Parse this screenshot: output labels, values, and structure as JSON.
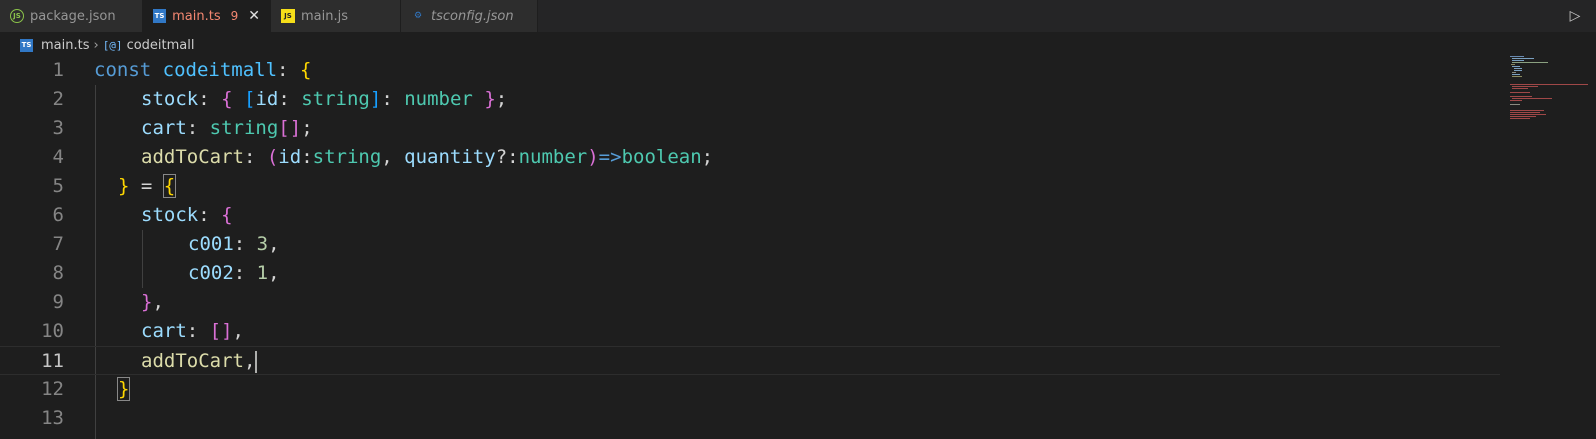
{
  "tabs": [
    {
      "label": "package.json",
      "icon": "json-file-icon",
      "badge": "",
      "italic": false
    },
    {
      "label": "main.ts",
      "icon": "typescript-file-icon",
      "badge": "9",
      "italic": false
    },
    {
      "label": "main.js",
      "icon": "javascript-file-icon",
      "badge": "",
      "italic": false
    },
    {
      "label": "tsconfig.json",
      "icon": "tsconfig-file-icon",
      "badge": "",
      "italic": true
    }
  ],
  "active_tab": "main.ts",
  "breadcrumb": {
    "file": "main.ts",
    "symbol": "codeitmall"
  },
  "line_numbers": [
    "1",
    "2",
    "3",
    "4",
    "5",
    "6",
    "7",
    "8",
    "9",
    "10",
    "11",
    "12",
    "13"
  ],
  "current_line": "11",
  "code": {
    "l1": [
      "const",
      " ",
      "codeitmall",
      ": ",
      "{"
    ],
    "l2": [
      "stock",
      ": ",
      "{",
      " ",
      "[",
      "id",
      ": ",
      "string",
      "]",
      ": ",
      "number",
      " ",
      "}",
      ";"
    ],
    "l3": [
      "cart",
      ": ",
      "string",
      "[]",
      ";"
    ],
    "l4": [
      "addToCart",
      ": ",
      "(",
      "id",
      ":",
      "string",
      ", ",
      "quantity",
      "?:",
      "number",
      ")",
      "=>",
      "boolean",
      ";"
    ],
    "l5": [
      "}",
      " = ",
      "{"
    ],
    "l6": [
      "stock",
      ": ",
      "{"
    ],
    "l7": [
      "c001",
      ": ",
      "3",
      ","
    ],
    "l8": [
      "c002",
      ": ",
      "1",
      ","
    ],
    "l9": [
      "}",
      ","
    ],
    "l10": [
      "cart",
      ": ",
      "[]",
      ","
    ],
    "l11": [
      "addToCart",
      ","
    ],
    "l12": [
      "}"
    ]
  },
  "colors": {
    "keyword": "#569cd6",
    "variable": "#4fc1ff",
    "property": "#9cdcfe",
    "type": "#4ec9b0",
    "function": "#dcdcaa",
    "number": "#b5cea8",
    "bracket_gold": "#ffd700",
    "bracket_pink": "#da70d6",
    "error_badge": "#f48771"
  }
}
